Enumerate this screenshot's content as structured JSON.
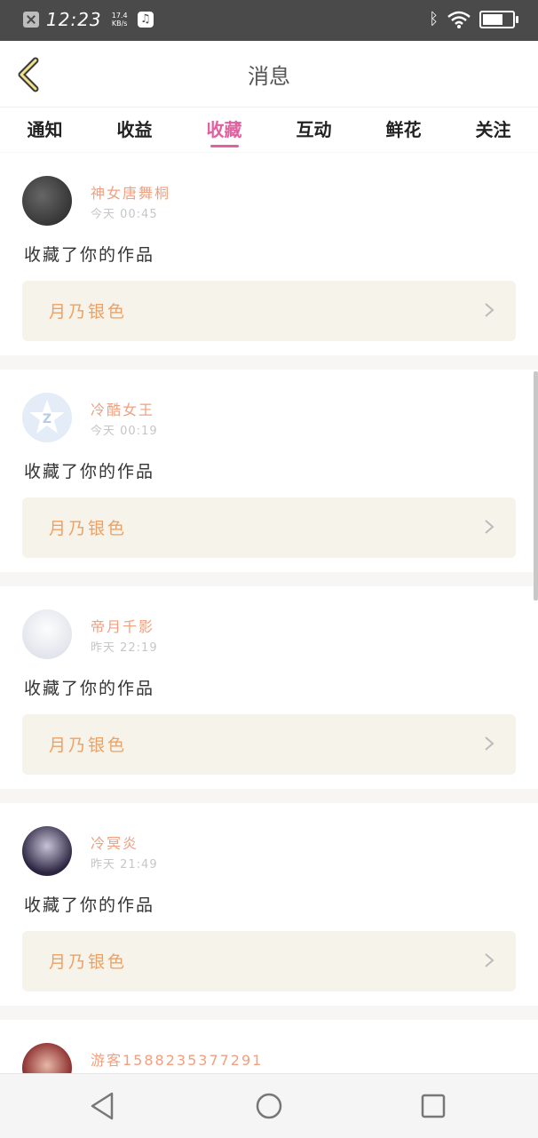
{
  "status_bar": {
    "time": "12:23",
    "net_speed_value": "17.4",
    "net_speed_unit": "KB/s",
    "battery_level": 0.7
  },
  "header": {
    "title": "消息",
    "back_icon": "chevron-left-icon"
  },
  "tabs": [
    {
      "label": "通知",
      "active": false
    },
    {
      "label": "收益",
      "active": false
    },
    {
      "label": "收藏",
      "active": true
    },
    {
      "label": "互动",
      "active": false
    },
    {
      "label": "鲜花",
      "active": false
    },
    {
      "label": "关注",
      "active": false
    }
  ],
  "messages": [
    {
      "user": "神女唐舞桐",
      "time": "今天 00:45",
      "text": "收藏了你的作品",
      "work": "月乃银色"
    },
    {
      "user": "冷酷女王",
      "time": "今天 00:19",
      "text": "收藏了你的作品",
      "work": "月乃银色"
    },
    {
      "user": "帝月千影",
      "time": "昨天 22:19",
      "text": "收藏了你的作品",
      "work": "月乃银色"
    },
    {
      "user": "冷冥炎",
      "time": "昨天 21:49",
      "text": "收藏了你的作品",
      "work": "月乃银色"
    },
    {
      "user": "游客15882353772​91",
      "time": "",
      "text": "",
      "work": ""
    }
  ],
  "colors": {
    "accent": "#e060a0",
    "username": "#f0a080",
    "work_title": "#f0a060"
  }
}
